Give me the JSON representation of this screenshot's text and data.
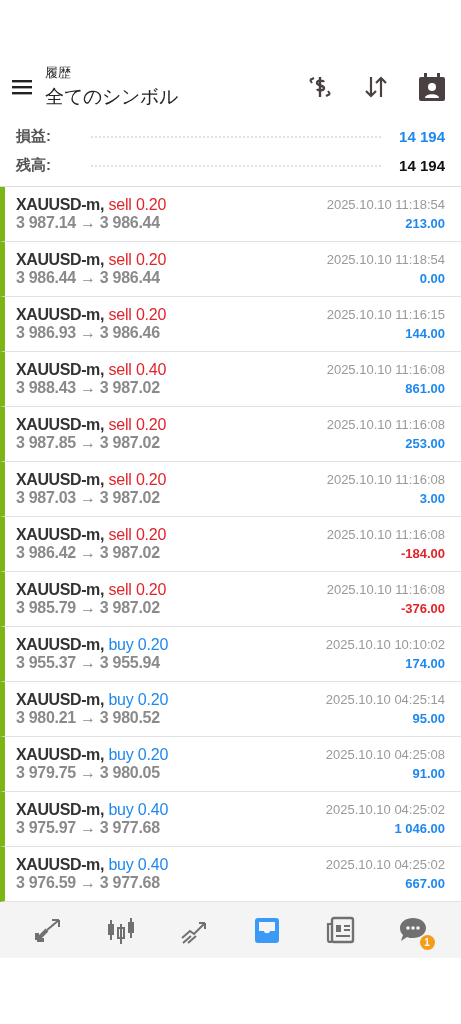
{
  "header": {
    "subtitle": "履歴",
    "title": "全てのシンボル"
  },
  "summary": [
    {
      "label": "損益:",
      "value": "14 194",
      "kind": "profit"
    },
    {
      "label": "残高:",
      "value": "14 194",
      "kind": "balance"
    }
  ],
  "deals": [
    {
      "symbol": "XAUUSD-m,",
      "kind": "sell",
      "volume": "sell 0.20",
      "prices": "3 987.14 → 3 986.44",
      "time": "2025.10.10 11:18:54",
      "profit": "213.00",
      "negative": false
    },
    {
      "symbol": "XAUUSD-m,",
      "kind": "sell",
      "volume": "sell 0.20",
      "prices": "3 986.44 → 3 986.44",
      "time": "2025.10.10 11:18:54",
      "profit": "0.00",
      "negative": false
    },
    {
      "symbol": "XAUUSD-m,",
      "kind": "sell",
      "volume": "sell 0.20",
      "prices": "3 986.93 → 3 986.46",
      "time": "2025.10.10 11:16:15",
      "profit": "144.00",
      "negative": false
    },
    {
      "symbol": "XAUUSD-m,",
      "kind": "sell",
      "volume": "sell 0.40",
      "prices": "3 988.43 → 3 987.02",
      "time": "2025.10.10 11:16:08",
      "profit": "861.00",
      "negative": false
    },
    {
      "symbol": "XAUUSD-m,",
      "kind": "sell",
      "volume": "sell 0.20",
      "prices": "3 987.85 → 3 987.02",
      "time": "2025.10.10 11:16:08",
      "profit": "253.00",
      "negative": false
    },
    {
      "symbol": "XAUUSD-m,",
      "kind": "sell",
      "volume": "sell 0.20",
      "prices": "3 987.03 → 3 987.02",
      "time": "2025.10.10 11:16:08",
      "profit": "3.00",
      "negative": false
    },
    {
      "symbol": "XAUUSD-m,",
      "kind": "sell",
      "volume": "sell 0.20",
      "prices": "3 986.42 → 3 987.02",
      "time": "2025.10.10 11:16:08",
      "profit": "-184.00",
      "negative": true
    },
    {
      "symbol": "XAUUSD-m,",
      "kind": "sell",
      "volume": "sell 0.20",
      "prices": "3 985.79 → 3 987.02",
      "time": "2025.10.10 11:16:08",
      "profit": "-376.00",
      "negative": true
    },
    {
      "symbol": "XAUUSD-m,",
      "kind": "buy",
      "volume": "buy 0.20",
      "prices": "3 955.37 → 3 955.94",
      "time": "2025.10.10 10:10:02",
      "profit": "174.00",
      "negative": false
    },
    {
      "symbol": "XAUUSD-m,",
      "kind": "buy",
      "volume": "buy 0.20",
      "prices": "3 980.21 → 3 980.52",
      "time": "2025.10.10 04:25:14",
      "profit": "95.00",
      "negative": false
    },
    {
      "symbol": "XAUUSD-m,",
      "kind": "buy",
      "volume": "buy 0.20",
      "prices": "3 979.75 → 3 980.05",
      "time": "2025.10.10 04:25:08",
      "profit": "91.00",
      "negative": false
    },
    {
      "symbol": "XAUUSD-m,",
      "kind": "buy",
      "volume": "buy 0.40",
      "prices": "3 975.97 → 3 977.68",
      "time": "2025.10.10 04:25:02",
      "profit": "1 046.00",
      "negative": false
    },
    {
      "symbol": "XAUUSD-m,",
      "kind": "buy",
      "volume": "buy 0.40",
      "prices": "3 976.59 → 3 977.68",
      "time": "2025.10.10 04:25:02",
      "profit": "667.00",
      "negative": false
    }
  ],
  "nav": [
    {
      "kind": "quotes",
      "selected": false
    },
    {
      "kind": "chart",
      "selected": false
    },
    {
      "kind": "trade",
      "selected": false
    },
    {
      "kind": "history",
      "selected": true
    },
    {
      "kind": "news",
      "selected": false
    },
    {
      "kind": "chat",
      "selected": false,
      "badge": "1"
    }
  ]
}
